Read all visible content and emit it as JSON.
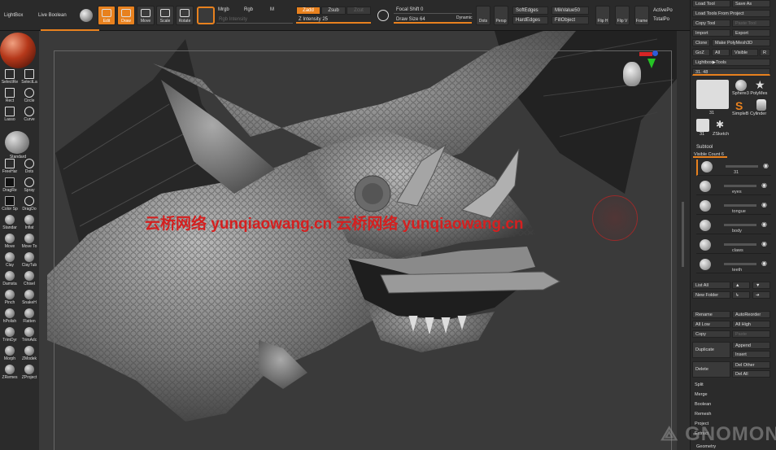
{
  "app": {
    "title": "ZBrush"
  },
  "topbar": {
    "lightbox": "LightBox",
    "live_boolean": "Live Boolean",
    "edit": "Edit",
    "draw": "Draw",
    "move": "Move",
    "scale": "Scale",
    "rotate": "Rotate",
    "mrgb": "Mrgb",
    "rgb": "Rgb",
    "m": "M",
    "rgb_intensity": "Rgb Intensity",
    "zadd": "Zadd",
    "zsub": "Zsub",
    "zcut": "Zcut",
    "z_intensity": "Z Intensity 25",
    "focal_shift": "Focal Shift 0",
    "draw_size": "Draw Size 64",
    "dynamic": "Dynamic",
    "dots": "Dots",
    "persp": "Persp",
    "softedges": "SoftEdges",
    "hardedges": "HardEdges",
    "mikvalue": "MikValue50",
    "fillobject": "FillObject",
    "flip_h": "Flip H",
    "flip_v": "Flip V",
    "frame": "Frame",
    "activepo": "ActivePo",
    "totalpo": "TotalPo"
  },
  "left_tools": [
    {
      "label": "SelectRe",
      "icon": "select-rect-icon"
    },
    {
      "label": "SelectLa",
      "icon": "select-lasso-icon"
    },
    {
      "label": "Rect",
      "icon": "rect-icon"
    },
    {
      "label": "Circle",
      "icon": "circle-icon"
    },
    {
      "label": "Lasso",
      "icon": "lasso-icon"
    },
    {
      "label": "Curve",
      "icon": "curve-icon"
    },
    {
      "label": "Standard",
      "icon": "standard-brush-icon"
    },
    {
      "label": "FreeHar",
      "icon": "freehand-icon"
    },
    {
      "label": "Dots",
      "icon": "dots-icon"
    },
    {
      "label": "DragRe",
      "icon": "dragrect-icon"
    },
    {
      "label": "Spray",
      "icon": "spray-icon"
    },
    {
      "label": "Color Sp",
      "icon": "colorspray-icon"
    },
    {
      "label": "DragDo",
      "icon": "dragdot-icon"
    },
    {
      "label": "Standar",
      "icon": "standard-icon"
    },
    {
      "label": "Inflat",
      "icon": "inflate-icon"
    },
    {
      "label": "Move",
      "icon": "move-brush-icon"
    },
    {
      "label": "Move To",
      "icon": "move-topo-icon"
    },
    {
      "label": "Clay",
      "icon": "clay-icon"
    },
    {
      "label": "ClayTub",
      "icon": "claytubes-icon"
    },
    {
      "label": "Damstа",
      "icon": "damstandard-icon"
    },
    {
      "label": "Chisel",
      "icon": "chisel-icon"
    },
    {
      "label": "Pinch",
      "icon": "pinch-icon"
    },
    {
      "label": "SnakeH",
      "icon": "snakehook-icon"
    },
    {
      "label": "hPolish",
      "icon": "hpolish-icon"
    },
    {
      "label": "Flatten",
      "icon": "flatten-icon"
    },
    {
      "label": "TrimDyr",
      "icon": "trimdynamic-icon"
    },
    {
      "label": "TrimAdc",
      "icon": "trimadaptive-icon"
    },
    {
      "label": "Morph",
      "icon": "morph-icon"
    },
    {
      "label": "ZModek",
      "icon": "zmodeler-icon"
    },
    {
      "label": "ZRemes",
      "icon": "zremesher-icon"
    },
    {
      "label": "ZProject",
      "icon": "zproject-icon"
    }
  ],
  "viewport": {
    "watermark": "云桥网络 yunqiaowang.cn 云桥网络 yunqiaowang.cn"
  },
  "right_panel": {
    "load_tool": "Load Tool",
    "save_as": "Save As",
    "load_tools_from_project": "Load Tools From Project",
    "copy_tool": "Copy Tool",
    "paste_tool": "Paste Tool",
    "import": "Import",
    "export": "Export",
    "clone": "Clone",
    "make_polymesh": "Make PolyMesh3D",
    "goz": "GoZ",
    "all": "All",
    "visible": "Visible",
    "r": "R",
    "lightbox_tools": "Lightbox▶Tools",
    "slider_value": "31. 48",
    "tool_thumbs": [
      "31",
      "Sphere3 PolyMes",
      "SimpleB Cylinder",
      "31",
      "ZSketch"
    ],
    "subtool_title": "Subtool",
    "visible_count": "Visible Count 6",
    "subtools": [
      "31",
      "eyes",
      "tongue",
      "body",
      "claws",
      "teeth"
    ],
    "list_all": "List All",
    "new_folder": "New Folder",
    "rename": "Rename",
    "auto_reorder": "AutoReorder",
    "all_low": "All Low",
    "all_high": "All High",
    "copy": "Copy",
    "paste": "Paste",
    "duplicate": "Duplicate",
    "append": "Append",
    "insert": "Insert",
    "delete": "Delete",
    "del_other": "Del Other",
    "del_all": "Del All",
    "split": "Split",
    "merge": "Merge",
    "boolean": "Boolean",
    "remesh": "Remesh",
    "project": "Project",
    "extract": "Extract",
    "geometry": "Geometry"
  },
  "colors": {
    "accent": "#e8811e",
    "watermark": "#d42020"
  }
}
